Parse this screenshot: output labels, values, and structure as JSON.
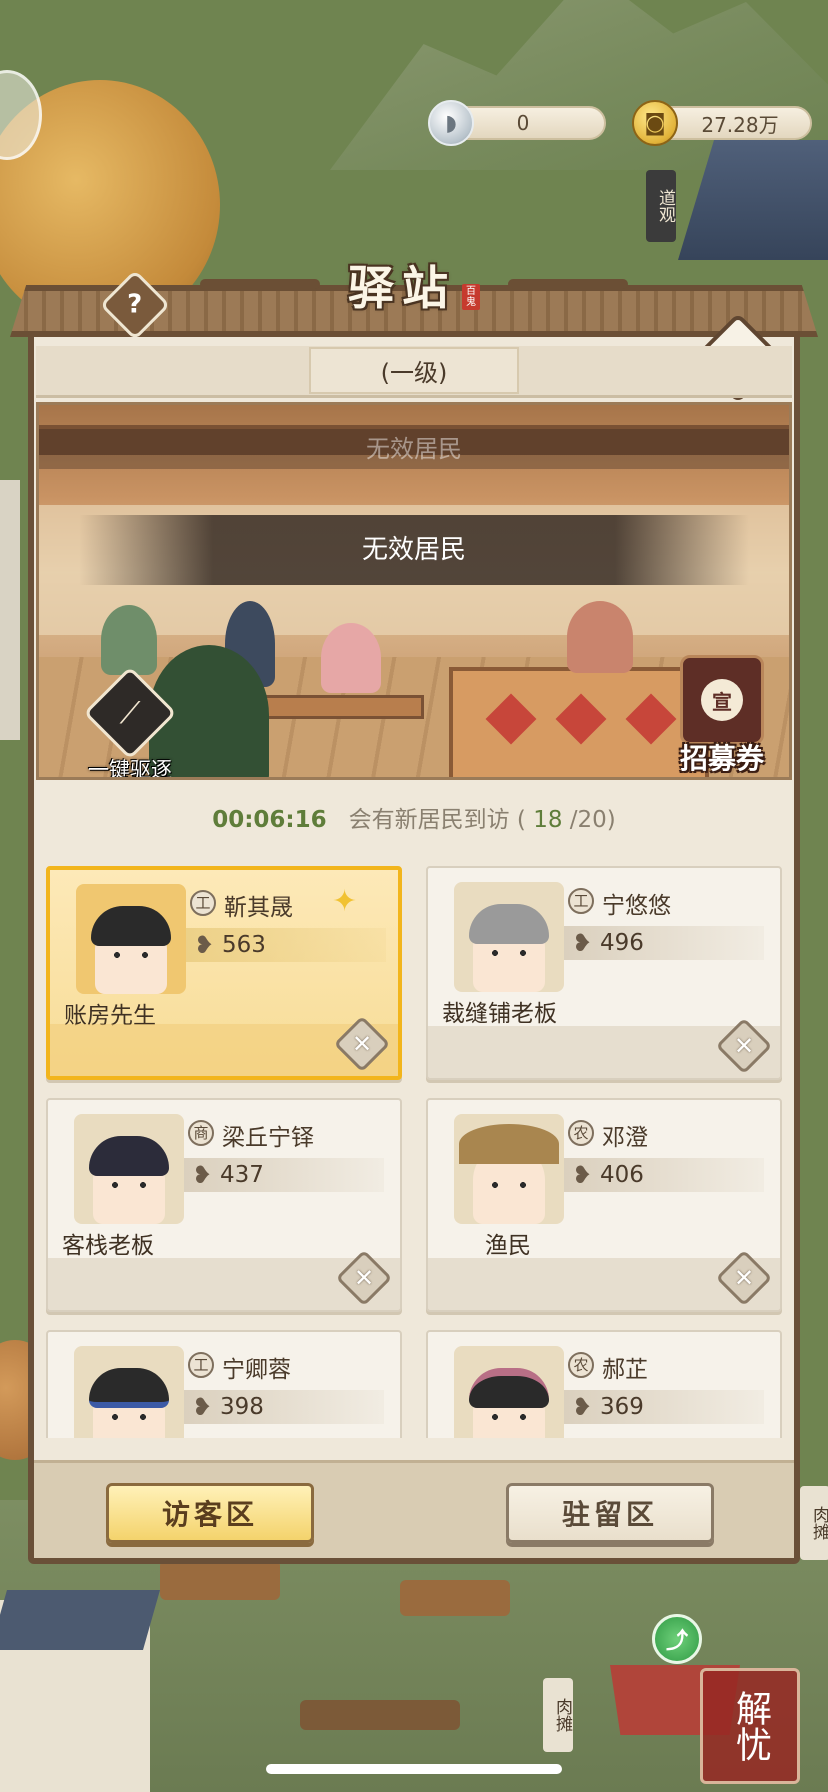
{
  "currency": {
    "silver_value": "0",
    "coin_value": "27.28万"
  },
  "world_signs": {
    "taoist_temple": "道观",
    "meat_stall_right": "肉摊",
    "meat_stall_bottom": "肉摊",
    "jieyou": "解忧"
  },
  "panel": {
    "title": "驿站",
    "title_seal": "百鬼",
    "level": "(一级)",
    "scene": {
      "ghost_banner": "无效居民",
      "banner": "无效居民",
      "expel_label": "一键驱逐",
      "recruit_label": "招募券",
      "recruit_icon_char": "宣"
    },
    "timer": {
      "countdown": "00:06:16",
      "message": "会有新居民到访 (",
      "current": "18",
      "max": "/20)"
    },
    "residents": [
      {
        "name": "靳其晟",
        "tag": "工",
        "value": "563",
        "role": "账房先生",
        "selected": true
      },
      {
        "name": "宁悠悠",
        "tag": "工",
        "value": "496",
        "role": "裁缝铺老板",
        "selected": false
      },
      {
        "name": "梁丘宁铎",
        "tag": "商",
        "value": "437",
        "role": "客栈老板",
        "selected": false
      },
      {
        "name": "邓澄",
        "tag": "农",
        "value": "406",
        "role": "渔民",
        "selected": false
      },
      {
        "name": "宁卿蓉",
        "tag": "工",
        "value": "398",
        "role": "",
        "selected": false
      },
      {
        "name": "郝芷",
        "tag": "农",
        "value": "369",
        "role": "",
        "selected": false
      }
    ],
    "tabs": {
      "visitor": "访客区",
      "resident": "驻留区"
    }
  },
  "icons": {
    "help": "?",
    "hammer": "⚒",
    "close": "✕",
    "heart": "❥",
    "arrow": "⤴",
    "sparkle": "✦"
  },
  "colors": {
    "selected_border": "#f2b51c",
    "timer_green": "#5f7d3a",
    "panel_frame": "#6a5038"
  }
}
